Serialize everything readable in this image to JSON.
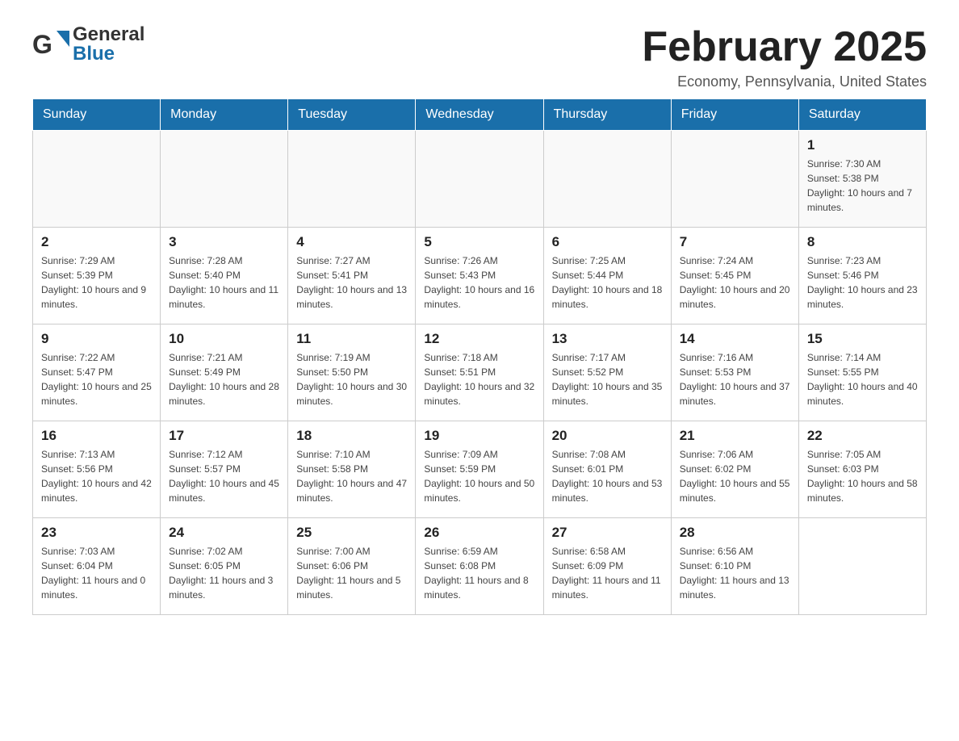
{
  "header": {
    "logo_line1": "General",
    "logo_line2": "Blue",
    "month_title": "February 2025",
    "location": "Economy, Pennsylvania, United States"
  },
  "days_of_week": [
    "Sunday",
    "Monday",
    "Tuesday",
    "Wednesday",
    "Thursday",
    "Friday",
    "Saturday"
  ],
  "weeks": [
    [
      {
        "day": "",
        "sunrise": "",
        "sunset": "",
        "daylight": ""
      },
      {
        "day": "",
        "sunrise": "",
        "sunset": "",
        "daylight": ""
      },
      {
        "day": "",
        "sunrise": "",
        "sunset": "",
        "daylight": ""
      },
      {
        "day": "",
        "sunrise": "",
        "sunset": "",
        "daylight": ""
      },
      {
        "day": "",
        "sunrise": "",
        "sunset": "",
        "daylight": ""
      },
      {
        "day": "",
        "sunrise": "",
        "sunset": "",
        "daylight": ""
      },
      {
        "day": "1",
        "sunrise": "Sunrise: 7:30 AM",
        "sunset": "Sunset: 5:38 PM",
        "daylight": "Daylight: 10 hours and 7 minutes."
      }
    ],
    [
      {
        "day": "2",
        "sunrise": "Sunrise: 7:29 AM",
        "sunset": "Sunset: 5:39 PM",
        "daylight": "Daylight: 10 hours and 9 minutes."
      },
      {
        "day": "3",
        "sunrise": "Sunrise: 7:28 AM",
        "sunset": "Sunset: 5:40 PM",
        "daylight": "Daylight: 10 hours and 11 minutes."
      },
      {
        "day": "4",
        "sunrise": "Sunrise: 7:27 AM",
        "sunset": "Sunset: 5:41 PM",
        "daylight": "Daylight: 10 hours and 13 minutes."
      },
      {
        "day": "5",
        "sunrise": "Sunrise: 7:26 AM",
        "sunset": "Sunset: 5:43 PM",
        "daylight": "Daylight: 10 hours and 16 minutes."
      },
      {
        "day": "6",
        "sunrise": "Sunrise: 7:25 AM",
        "sunset": "Sunset: 5:44 PM",
        "daylight": "Daylight: 10 hours and 18 minutes."
      },
      {
        "day": "7",
        "sunrise": "Sunrise: 7:24 AM",
        "sunset": "Sunset: 5:45 PM",
        "daylight": "Daylight: 10 hours and 20 minutes."
      },
      {
        "day": "8",
        "sunrise": "Sunrise: 7:23 AM",
        "sunset": "Sunset: 5:46 PM",
        "daylight": "Daylight: 10 hours and 23 minutes."
      }
    ],
    [
      {
        "day": "9",
        "sunrise": "Sunrise: 7:22 AM",
        "sunset": "Sunset: 5:47 PM",
        "daylight": "Daylight: 10 hours and 25 minutes."
      },
      {
        "day": "10",
        "sunrise": "Sunrise: 7:21 AM",
        "sunset": "Sunset: 5:49 PM",
        "daylight": "Daylight: 10 hours and 28 minutes."
      },
      {
        "day": "11",
        "sunrise": "Sunrise: 7:19 AM",
        "sunset": "Sunset: 5:50 PM",
        "daylight": "Daylight: 10 hours and 30 minutes."
      },
      {
        "day": "12",
        "sunrise": "Sunrise: 7:18 AM",
        "sunset": "Sunset: 5:51 PM",
        "daylight": "Daylight: 10 hours and 32 minutes."
      },
      {
        "day": "13",
        "sunrise": "Sunrise: 7:17 AM",
        "sunset": "Sunset: 5:52 PM",
        "daylight": "Daylight: 10 hours and 35 minutes."
      },
      {
        "day": "14",
        "sunrise": "Sunrise: 7:16 AM",
        "sunset": "Sunset: 5:53 PM",
        "daylight": "Daylight: 10 hours and 37 minutes."
      },
      {
        "day": "15",
        "sunrise": "Sunrise: 7:14 AM",
        "sunset": "Sunset: 5:55 PM",
        "daylight": "Daylight: 10 hours and 40 minutes."
      }
    ],
    [
      {
        "day": "16",
        "sunrise": "Sunrise: 7:13 AM",
        "sunset": "Sunset: 5:56 PM",
        "daylight": "Daylight: 10 hours and 42 minutes."
      },
      {
        "day": "17",
        "sunrise": "Sunrise: 7:12 AM",
        "sunset": "Sunset: 5:57 PM",
        "daylight": "Daylight: 10 hours and 45 minutes."
      },
      {
        "day": "18",
        "sunrise": "Sunrise: 7:10 AM",
        "sunset": "Sunset: 5:58 PM",
        "daylight": "Daylight: 10 hours and 47 minutes."
      },
      {
        "day": "19",
        "sunrise": "Sunrise: 7:09 AM",
        "sunset": "Sunset: 5:59 PM",
        "daylight": "Daylight: 10 hours and 50 minutes."
      },
      {
        "day": "20",
        "sunrise": "Sunrise: 7:08 AM",
        "sunset": "Sunset: 6:01 PM",
        "daylight": "Daylight: 10 hours and 53 minutes."
      },
      {
        "day": "21",
        "sunrise": "Sunrise: 7:06 AM",
        "sunset": "Sunset: 6:02 PM",
        "daylight": "Daylight: 10 hours and 55 minutes."
      },
      {
        "day": "22",
        "sunrise": "Sunrise: 7:05 AM",
        "sunset": "Sunset: 6:03 PM",
        "daylight": "Daylight: 10 hours and 58 minutes."
      }
    ],
    [
      {
        "day": "23",
        "sunrise": "Sunrise: 7:03 AM",
        "sunset": "Sunset: 6:04 PM",
        "daylight": "Daylight: 11 hours and 0 minutes."
      },
      {
        "day": "24",
        "sunrise": "Sunrise: 7:02 AM",
        "sunset": "Sunset: 6:05 PM",
        "daylight": "Daylight: 11 hours and 3 minutes."
      },
      {
        "day": "25",
        "sunrise": "Sunrise: 7:00 AM",
        "sunset": "Sunset: 6:06 PM",
        "daylight": "Daylight: 11 hours and 5 minutes."
      },
      {
        "day": "26",
        "sunrise": "Sunrise: 6:59 AM",
        "sunset": "Sunset: 6:08 PM",
        "daylight": "Daylight: 11 hours and 8 minutes."
      },
      {
        "day": "27",
        "sunrise": "Sunrise: 6:58 AM",
        "sunset": "Sunset: 6:09 PM",
        "daylight": "Daylight: 11 hours and 11 minutes."
      },
      {
        "day": "28",
        "sunrise": "Sunrise: 6:56 AM",
        "sunset": "Sunset: 6:10 PM",
        "daylight": "Daylight: 11 hours and 13 minutes."
      },
      {
        "day": "",
        "sunrise": "",
        "sunset": "",
        "daylight": ""
      }
    ]
  ]
}
